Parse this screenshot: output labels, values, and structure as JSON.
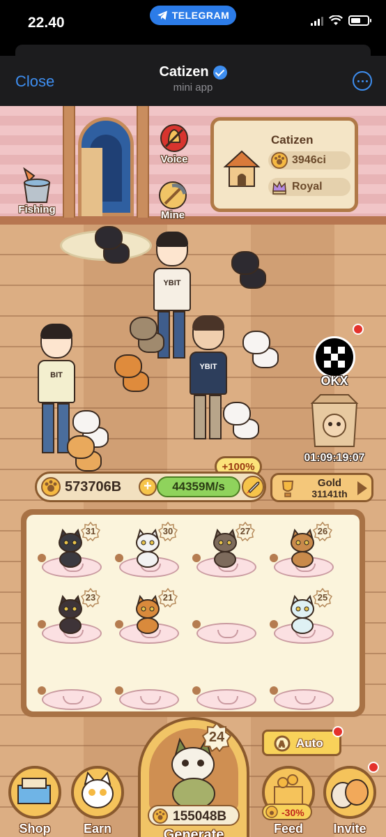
{
  "status_bar": {
    "time": "22.40",
    "pill_label": "TELEGRAM"
  },
  "header": {
    "close_label": "Close",
    "title": "Catizen",
    "subtitle": "mini app"
  },
  "scene": {
    "voice_label": "Voice",
    "fishing_label": "Fishing",
    "mine_label": "Mine",
    "okx_label": "OKX",
    "gift_timer": "01:09:19:07",
    "boost_label": "+100%"
  },
  "info_card": {
    "title": "Catizen",
    "currency_value": "3946ci",
    "rank": "Royal"
  },
  "resources": {
    "coins": "573706B",
    "rate": "44359M/s"
  },
  "league": {
    "name": "Gold",
    "score": "31141th"
  },
  "cat_grid": {
    "slots": [
      {
        "level": "31",
        "occupied": true,
        "color": "#3a3a40"
      },
      {
        "level": "30",
        "occupied": true,
        "color": "#f2f2f2"
      },
      {
        "level": "27",
        "occupied": true,
        "color": "#7d6b5c"
      },
      {
        "level": "26",
        "occupied": true,
        "color": "#c98a4b"
      },
      {
        "level": "23",
        "occupied": true,
        "color": "#3e3438"
      },
      {
        "level": "21",
        "occupied": true,
        "color": "#d98a3c"
      },
      {
        "level": "",
        "occupied": false,
        "color": ""
      },
      {
        "level": "25",
        "occupied": true,
        "color": "#dff1f4"
      },
      {
        "level": "",
        "occupied": false,
        "color": ""
      },
      {
        "level": "",
        "occupied": false,
        "color": ""
      },
      {
        "level": "",
        "occupied": false,
        "color": ""
      },
      {
        "level": "",
        "occupied": false,
        "color": ""
      }
    ]
  },
  "bottom": {
    "auto_label": "Auto",
    "generate_level": "24",
    "generate_price": "155048B",
    "generate_label": "Generate",
    "nav": {
      "shop": "Shop",
      "earn": "Earn",
      "feed": "Feed",
      "feed_discount": "-30%",
      "invite": "Invite"
    }
  },
  "colors": {
    "accent": "#3e8ef0",
    "wood": "#8a5a2e",
    "panel_bg": "#fbf4dc",
    "rate_green": "#8fd35c"
  }
}
